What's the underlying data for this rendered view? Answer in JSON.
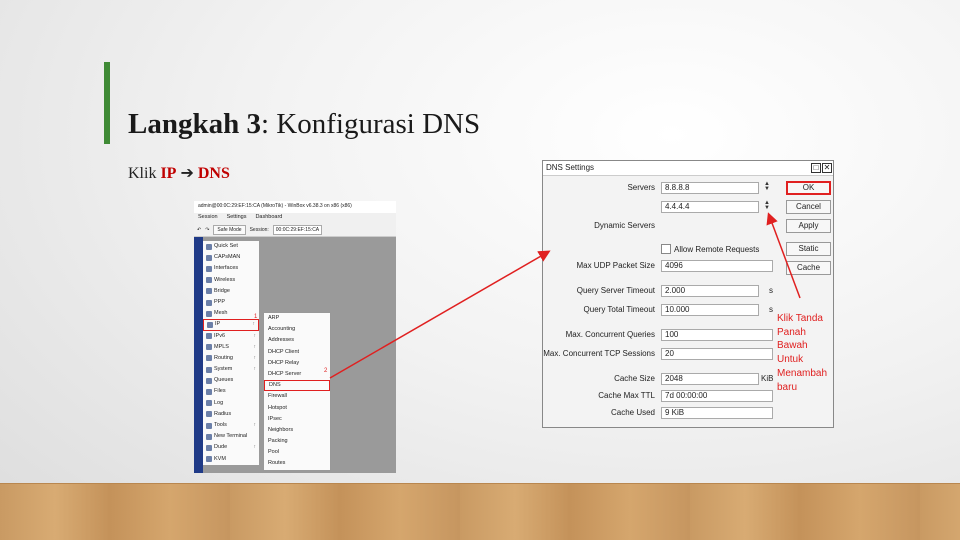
{
  "slide": {
    "title_bold": "Langkah 3",
    "title_rest": ": Konfigurasi DNS",
    "subtitle_prefix": "Klik",
    "subtitle_ip": "IP",
    "subtitle_arrow": "➔",
    "subtitle_dns": "DNS"
  },
  "winbox": {
    "title": "admin@00:0C:29:EF:15:CA (MikroTik) - WinBox v6.38.3 on x86 (x86)",
    "menubar": [
      "Session",
      "Settings",
      "Dashboard"
    ],
    "toolbar": {
      "undo": "↶",
      "redo": "↷",
      "safe_mode": "Safe Mode",
      "session_label": "Session:",
      "session_value": "00:0C:29:EF:15:CA"
    },
    "menu": [
      {
        "label": "Quick Set",
        "icon": "quick-set-icon",
        "arrow": ""
      },
      {
        "label": "CAPsMAN",
        "icon": "capsman-icon",
        "arrow": ""
      },
      {
        "label": "Interfaces",
        "icon": "interfaces-icon",
        "arrow": ""
      },
      {
        "label": "Wireless",
        "icon": "wireless-icon",
        "arrow": ""
      },
      {
        "label": "Bridge",
        "icon": "bridge-icon",
        "arrow": ""
      },
      {
        "label": "PPP",
        "icon": "ppp-icon",
        "arrow": ""
      },
      {
        "label": "Mesh",
        "icon": "mesh-icon",
        "arrow": ""
      },
      {
        "label": "IP",
        "icon": "ip-icon",
        "arrow": "↑"
      },
      {
        "label": "IPv6",
        "icon": "ipv6-icon",
        "arrow": "↑"
      },
      {
        "label": "MPLS",
        "icon": "mpls-icon",
        "arrow": "↑"
      },
      {
        "label": "Routing",
        "icon": "routing-icon",
        "arrow": "↑"
      },
      {
        "label": "System",
        "icon": "system-icon",
        "arrow": "↑"
      },
      {
        "label": "Queues",
        "icon": "queues-icon",
        "arrow": ""
      },
      {
        "label": "Files",
        "icon": "files-icon",
        "arrow": ""
      },
      {
        "label": "Log",
        "icon": "log-icon",
        "arrow": ""
      },
      {
        "label": "Radius",
        "icon": "radius-icon",
        "arrow": ""
      },
      {
        "label": "Tools",
        "icon": "tools-icon",
        "arrow": "↑"
      },
      {
        "label": "New Terminal",
        "icon": "terminal-icon",
        "arrow": ""
      },
      {
        "label": "Dude",
        "icon": "dude-icon",
        "arrow": "↑"
      },
      {
        "label": "KVM",
        "icon": "kvm-icon",
        "arrow": ""
      }
    ],
    "selected_menu": "IP",
    "marker_1": "1",
    "submenu": [
      "ARP",
      "Accounting",
      "Addresses",
      "DHCP Client",
      "DHCP Relay",
      "DHCP Server",
      "DNS",
      "Firewall",
      "Hotspot",
      "IPsec",
      "Neighbors",
      "Packing",
      "Pool",
      "Routes"
    ],
    "selected_submenu": "DNS",
    "marker_2": "2"
  },
  "dns_dialog": {
    "title": "DNS Settings",
    "fields": {
      "servers_label": "Servers",
      "server1": "8.8.8.8",
      "server2": "4.4.4.4",
      "dynamic_servers_label": "Dynamic Servers",
      "allow_remote_label": "Allow Remote Requests",
      "max_udp_label": "Max UDP Packet Size",
      "max_udp_value": "4096",
      "query_server_timeout_label": "Query Server Timeout",
      "query_server_timeout_value": "2.000",
      "query_total_timeout_label": "Query Total Timeout",
      "query_total_timeout_value": "10.000",
      "seconds_unit": "s",
      "max_concurrent_queries_label": "Max. Concurrent Queries",
      "max_concurrent_queries_value": "100",
      "max_concurrent_tcp_label": "Max. Concurrent TCP Sessions",
      "max_concurrent_tcp_value": "20",
      "cache_size_label": "Cache Size",
      "cache_size_value": "2048",
      "kib_unit": "KiB",
      "cache_max_ttl_label": "Cache Max TTL",
      "cache_max_ttl_value": "7d 00:00:00",
      "cache_used_label": "Cache Used",
      "cache_used_value": "9 KiB"
    },
    "buttons": {
      "ok": "OK",
      "cancel": "Cancel",
      "apply": "Apply",
      "static": "Static",
      "cache": "Cache"
    },
    "titlebar_buttons": {
      "restore": "□",
      "close": "✕"
    }
  },
  "annotation_lines": [
    "Klik Tanda",
    "Panah",
    "Bawah",
    "Untuk",
    "Menambah",
    "baru"
  ],
  "colors": {
    "accent_green": "#3f8a35",
    "highlight_red": "#c00000",
    "annotation_red": "#e02020",
    "winbox_strip": "#1f3a87"
  }
}
